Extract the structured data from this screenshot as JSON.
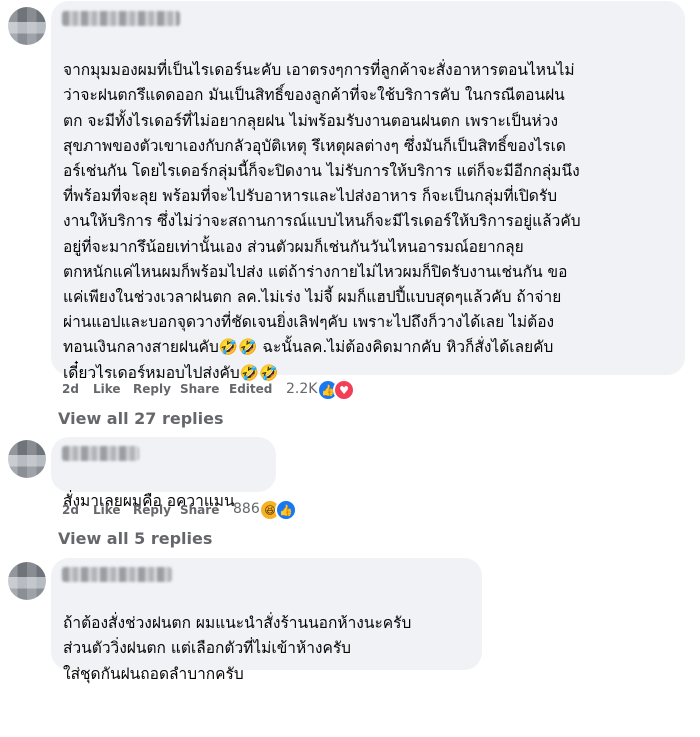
{
  "comments": [
    {
      "author": "",
      "lines": [
        "จากมุมมองผมที่เป็นไรเดอร์นะคับ เอาตรงๆการที่ลูกค้าจะสั่งอาหารตอนไหนไม่",
        "ว่าจะฝนตกรึแดดออก มันเป็นสิทธิ์ของลูกค้าที่จะใช้บริการคับ ในกรณีตอนฝน",
        "ตก จะมีทั้งไรเดอร์ที่ไม่อยากลุยฝน ไม่พร้อมรับงานตอนฝนตก เพราะเป็นห่วง",
        "สุขภาพของตัวเขาเองกับกลัวอุบัติเหตุ รึเหตุผลต่างๆ ซึ่งมันก็เป็นสิทธิ์ของไรเด",
        "อร์เช่นกัน โดยไรเดอร์กลุ่มนี้ก็จะปิดงาน ไม่รับการให้บริการ แต่ก็จะมีอีกกลุ่มนึง",
        "ที่พร้อมที่จะลุย พร้อมที่จะไปรับอาหารและไปส่งอาหาร ก็จะเป็นกลุ่มที่เปิดรับ",
        "งานให้บริการ ซึ่งไม่ว่าจะสถานการณ์แบบไหนก็จะมีไรเดอร์ให้บริการอยู่แล้วคับ",
        "อยู่ที่จะมากรึน้อยเท่านั้นเอง ส่วนตัวผมก็เช่นกันวันไหนอารมณ์อยากลุย",
        "ตกหนักแค่ไหนผมก็พร้อมไปส่ง แต่ถ้าร่างกายไม่ไหวผมก็ปิดรับงานเช่นกัน ขอ",
        "แค่เพียงในช่วงเวลาฝนตก ลค.ไม่เร่ง ไม่จี้ ผมก็แฮปปี้แบบสุดๆแล้วคับ ถ้าจ่าย",
        "ผ่านแอปและบอกจุดวางที่ชัดเจนยิ่งเลิฟๆคับ เพราะไปถึงก็วางได้เลย ไม่ต้อง",
        "ทอนเงินกลางสายฝนคับ🤣🤣 ฉะนั้นลค.ไม่ต้องคิดมากคับ หิวก็สั่งได้เลยคับ",
        "เดี๋ยวไรเดอร์หมอบไปส่งคับ🤣🤣"
      ],
      "time": "2d",
      "like": "Like",
      "reply": "Reply",
      "share": "Share",
      "edited": "Edited",
      "reactions": "2.2K",
      "reaction_icons": [
        "like-icon",
        "love-icon"
      ],
      "view_replies": "View all 27 replies"
    },
    {
      "author": "",
      "lines": [
        "สั่งมาเลยผมคือ อควาแมน"
      ],
      "time": "2d",
      "like": "Like",
      "reply": "Reply",
      "share": "Share",
      "reactions": "886",
      "reaction_icons": [
        "haha-icon",
        "like-icon"
      ],
      "view_replies": "View all 5 replies"
    },
    {
      "author": "",
      "lines": [
        "ถ้าต้องสั่งช่วงฝนตก ผมแนะนำสั่งร้านนอกห้างนะครับ",
        "ส่วนตัววิ่งฝนตก แต่เลือกตัวที่ไม่เข้าห้างครับ",
        "ใส่ชุดกันฝนถอดลำบากครับ"
      ]
    }
  ],
  "colors": {
    "bubble": "#f0f2f5",
    "meta_text": "#65676b",
    "like_blue": "#1877f2",
    "love_red": "#f33e58",
    "haha_yellow": "#f7b125"
  }
}
